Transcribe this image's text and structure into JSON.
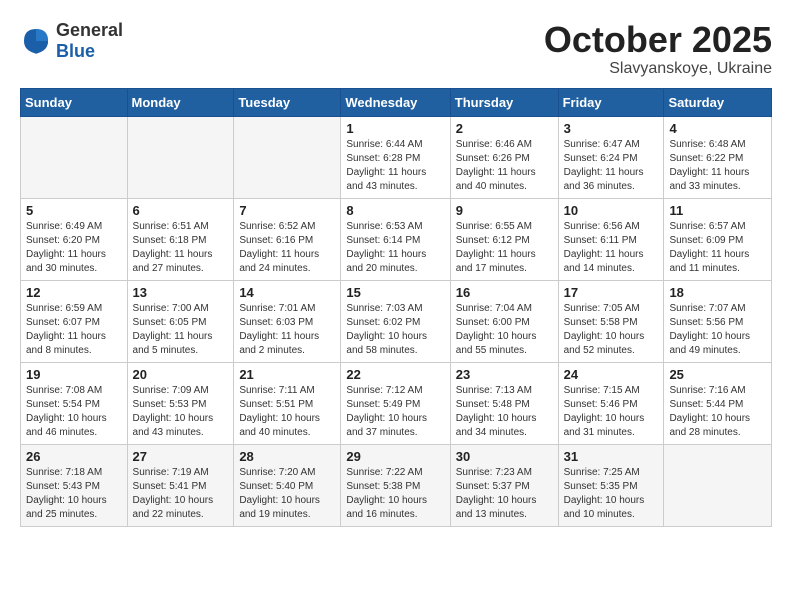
{
  "header": {
    "logo": {
      "general": "General",
      "blue": "Blue"
    },
    "month": "October 2025",
    "location": "Slavyanskoye, Ukraine"
  },
  "weekdays": [
    "Sunday",
    "Monday",
    "Tuesday",
    "Wednesday",
    "Thursday",
    "Friday",
    "Saturday"
  ],
  "weeks": [
    [
      {
        "day": "",
        "info": ""
      },
      {
        "day": "",
        "info": ""
      },
      {
        "day": "",
        "info": ""
      },
      {
        "day": "1",
        "info": "Sunrise: 6:44 AM\nSunset: 6:28 PM\nDaylight: 11 hours\nand 43 minutes."
      },
      {
        "day": "2",
        "info": "Sunrise: 6:46 AM\nSunset: 6:26 PM\nDaylight: 11 hours\nand 40 minutes."
      },
      {
        "day": "3",
        "info": "Sunrise: 6:47 AM\nSunset: 6:24 PM\nDaylight: 11 hours\nand 36 minutes."
      },
      {
        "day": "4",
        "info": "Sunrise: 6:48 AM\nSunset: 6:22 PM\nDaylight: 11 hours\nand 33 minutes."
      }
    ],
    [
      {
        "day": "5",
        "info": "Sunrise: 6:49 AM\nSunset: 6:20 PM\nDaylight: 11 hours\nand 30 minutes."
      },
      {
        "day": "6",
        "info": "Sunrise: 6:51 AM\nSunset: 6:18 PM\nDaylight: 11 hours\nand 27 minutes."
      },
      {
        "day": "7",
        "info": "Sunrise: 6:52 AM\nSunset: 6:16 PM\nDaylight: 11 hours\nand 24 minutes."
      },
      {
        "day": "8",
        "info": "Sunrise: 6:53 AM\nSunset: 6:14 PM\nDaylight: 11 hours\nand 20 minutes."
      },
      {
        "day": "9",
        "info": "Sunrise: 6:55 AM\nSunset: 6:12 PM\nDaylight: 11 hours\nand 17 minutes."
      },
      {
        "day": "10",
        "info": "Sunrise: 6:56 AM\nSunset: 6:11 PM\nDaylight: 11 hours\nand 14 minutes."
      },
      {
        "day": "11",
        "info": "Sunrise: 6:57 AM\nSunset: 6:09 PM\nDaylight: 11 hours\nand 11 minutes."
      }
    ],
    [
      {
        "day": "12",
        "info": "Sunrise: 6:59 AM\nSunset: 6:07 PM\nDaylight: 11 hours\nand 8 minutes."
      },
      {
        "day": "13",
        "info": "Sunrise: 7:00 AM\nSunset: 6:05 PM\nDaylight: 11 hours\nand 5 minutes."
      },
      {
        "day": "14",
        "info": "Sunrise: 7:01 AM\nSunset: 6:03 PM\nDaylight: 11 hours\nand 2 minutes."
      },
      {
        "day": "15",
        "info": "Sunrise: 7:03 AM\nSunset: 6:02 PM\nDaylight: 10 hours\nand 58 minutes."
      },
      {
        "day": "16",
        "info": "Sunrise: 7:04 AM\nSunset: 6:00 PM\nDaylight: 10 hours\nand 55 minutes."
      },
      {
        "day": "17",
        "info": "Sunrise: 7:05 AM\nSunset: 5:58 PM\nDaylight: 10 hours\nand 52 minutes."
      },
      {
        "day": "18",
        "info": "Sunrise: 7:07 AM\nSunset: 5:56 PM\nDaylight: 10 hours\nand 49 minutes."
      }
    ],
    [
      {
        "day": "19",
        "info": "Sunrise: 7:08 AM\nSunset: 5:54 PM\nDaylight: 10 hours\nand 46 minutes."
      },
      {
        "day": "20",
        "info": "Sunrise: 7:09 AM\nSunset: 5:53 PM\nDaylight: 10 hours\nand 43 minutes."
      },
      {
        "day": "21",
        "info": "Sunrise: 7:11 AM\nSunset: 5:51 PM\nDaylight: 10 hours\nand 40 minutes."
      },
      {
        "day": "22",
        "info": "Sunrise: 7:12 AM\nSunset: 5:49 PM\nDaylight: 10 hours\nand 37 minutes."
      },
      {
        "day": "23",
        "info": "Sunrise: 7:13 AM\nSunset: 5:48 PM\nDaylight: 10 hours\nand 34 minutes."
      },
      {
        "day": "24",
        "info": "Sunrise: 7:15 AM\nSunset: 5:46 PM\nDaylight: 10 hours\nand 31 minutes."
      },
      {
        "day": "25",
        "info": "Sunrise: 7:16 AM\nSunset: 5:44 PM\nDaylight: 10 hours\nand 28 minutes."
      }
    ],
    [
      {
        "day": "26",
        "info": "Sunrise: 7:18 AM\nSunset: 5:43 PM\nDaylight: 10 hours\nand 25 minutes."
      },
      {
        "day": "27",
        "info": "Sunrise: 7:19 AM\nSunset: 5:41 PM\nDaylight: 10 hours\nand 22 minutes."
      },
      {
        "day": "28",
        "info": "Sunrise: 7:20 AM\nSunset: 5:40 PM\nDaylight: 10 hours\nand 19 minutes."
      },
      {
        "day": "29",
        "info": "Sunrise: 7:22 AM\nSunset: 5:38 PM\nDaylight: 10 hours\nand 16 minutes."
      },
      {
        "day": "30",
        "info": "Sunrise: 7:23 AM\nSunset: 5:37 PM\nDaylight: 10 hours\nand 13 minutes."
      },
      {
        "day": "31",
        "info": "Sunrise: 7:25 AM\nSunset: 5:35 PM\nDaylight: 10 hours\nand 10 minutes."
      },
      {
        "day": "",
        "info": ""
      }
    ]
  ]
}
